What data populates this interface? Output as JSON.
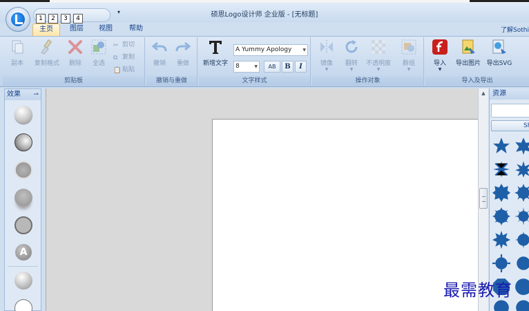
{
  "window": {
    "title": "硕思Logo设计师 企业版 - [无标题]"
  },
  "quick_access": {
    "keys": [
      "1",
      "2",
      "3",
      "4"
    ],
    "customize_glyph": "▾"
  },
  "tabs": [
    {
      "label": "主页",
      "active": true
    },
    {
      "label": "图层",
      "active": false
    },
    {
      "label": "视图",
      "active": false
    },
    {
      "label": "帮助",
      "active": false
    }
  ],
  "help_link": "了解Sothi",
  "ribbon": {
    "clipboard": {
      "label": "剪贴板",
      "copy": "副本",
      "copy_format": "复制格式",
      "delete": "删除",
      "select_all": "全选",
      "cut": "剪切",
      "duplicate": "复制",
      "paste": "粘贴"
    },
    "undo_redo": {
      "label": "撤销与重做",
      "undo": "撤销",
      "redo": "重做"
    },
    "text_style": {
      "label": "文字样式",
      "new_text": "新增文字",
      "font_name": "A Yummy Apology",
      "font_size": "8",
      "spacing_btn": "AB",
      "bold": "B",
      "italic": "I"
    },
    "operate": {
      "label": "操作对象",
      "mirror": "镜像",
      "flip": "翻转",
      "opacity": "不透明度",
      "group": "群组"
    },
    "import_export": {
      "label": "导入及导出",
      "import": "导入",
      "export_image": "导出图片",
      "export_svg": "导出SVG"
    }
  },
  "effects_panel": {
    "title": "效果",
    "pin": "⇀",
    "text_effect_letter": "A"
  },
  "resources_panel": {
    "title": "资源",
    "button": "Sh"
  },
  "scrollbar": {
    "up": "▲",
    "down": "▼"
  },
  "watermark": "最需教育",
  "colors": {
    "ribbon_bg": "#c7d9ee",
    "active_tab": "#ffe6a6",
    "shape_blue": "#1f5fa8",
    "watermark": "#1a1ab0"
  }
}
